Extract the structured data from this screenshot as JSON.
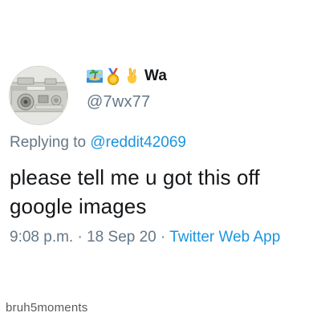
{
  "tweet": {
    "display_name": "Wa",
    "name_emojis": [
      "desert-island-emoji",
      "medal-emoji",
      "crossed-fingers-emoji"
    ],
    "handle": "@7wx77",
    "reply": {
      "prefix": "Replying to ",
      "mention": "@reddit42069"
    },
    "text_lines": [
      "please tell me u got this off",
      "google images"
    ],
    "meta": {
      "time": "9:08 p.m.",
      "separator_1": " · ",
      "date": "18 Sep 20",
      "separator_2": " · ",
      "source": "Twitter Web App"
    }
  },
  "watermark": "bruh5moments",
  "colors": {
    "text_primary": "#14171a",
    "text_secondary": "#657786",
    "link": "#1b95e0",
    "background": "#ffffff"
  }
}
